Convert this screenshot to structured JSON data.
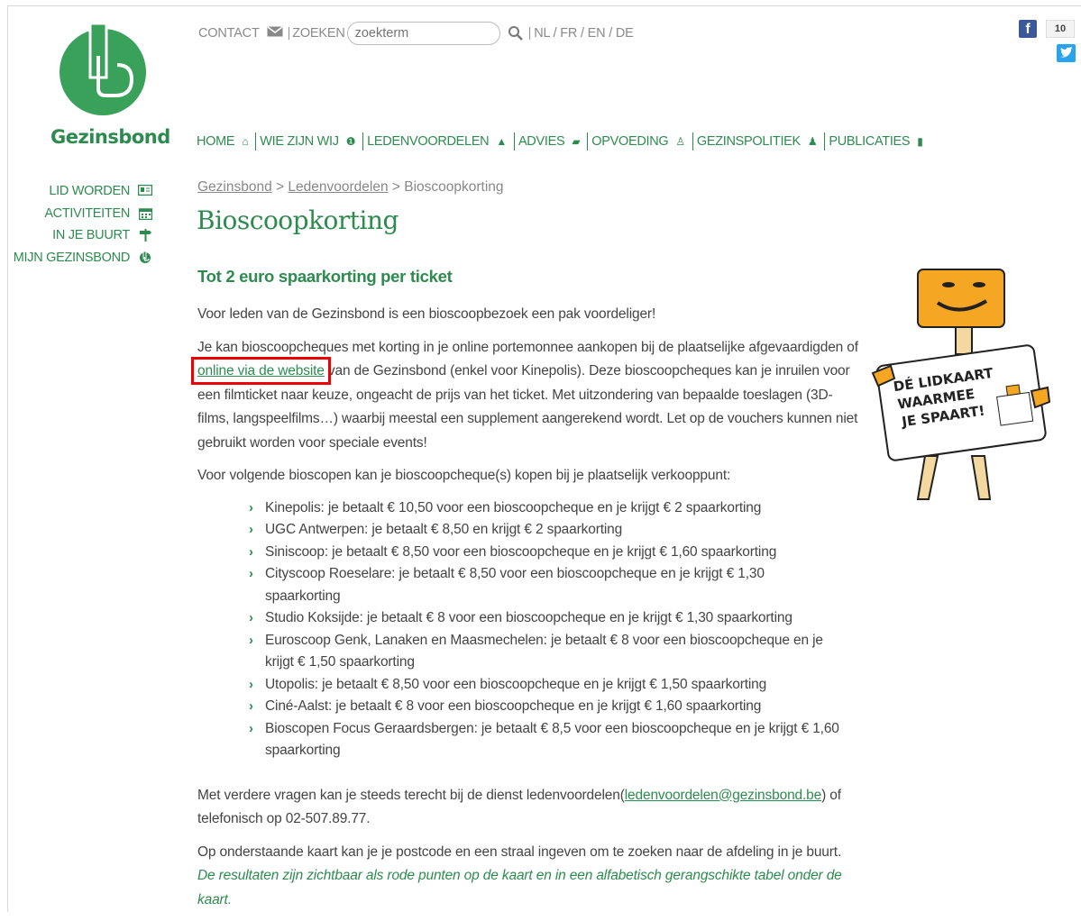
{
  "brand": {
    "name": "Gezinsbond"
  },
  "topbar": {
    "contact_label": "CONTACT",
    "zoeken_label": "ZOEKEN",
    "search_placeholder": "zoekterm",
    "languages": "NL / FR / EN / DE"
  },
  "social": {
    "facebook_count": "10"
  },
  "left_nav": [
    {
      "label": "LID WORDEN",
      "icon": "id-card-icon"
    },
    {
      "label": "ACTIVITEITEN",
      "icon": "calendar-icon"
    },
    {
      "label": "IN JE BUURT",
      "icon": "signpost-icon"
    },
    {
      "label": "MIJN GEZINSBOND",
      "icon": "gezinsbond-logo-icon"
    }
  ],
  "main_nav": [
    {
      "label": "HOME",
      "icon": "home-icon",
      "glyph": "⌂"
    },
    {
      "label": "WIE ZIJN WIJ",
      "icon": "info-icon",
      "glyph": "❶"
    },
    {
      "label": "LEDENVOORDELEN",
      "icon": "user-icon",
      "glyph": "▲"
    },
    {
      "label": "ADVIES",
      "icon": "chat-icon",
      "glyph": "▰"
    },
    {
      "label": "OPVOEDING",
      "icon": "child-icon",
      "glyph": "♙"
    },
    {
      "label": "GEZINSPOLITIEK",
      "icon": "family-icon",
      "glyph": "♟"
    },
    {
      "label": "PUBLICATIES",
      "icon": "book-icon",
      "glyph": "▮"
    }
  ],
  "breadcrumb": {
    "home": "Gezinsbond",
    "sep1": " > ",
    "section": "Ledenvoordelen",
    "sep2": " > ",
    "current": "Bioscoopkorting"
  },
  "page": {
    "title": "Bioscoopkorting",
    "subheading": "Tot 2 euro spaarkorting per ticket",
    "intro": "Voor leden van de Gezinsbond is een bioscoopbezoek een pak voordeliger!",
    "p2_before": "Je kan bioscoopcheques met korting in je online portemonnee aankopen bij de plaatselijke afgevaardigden of ",
    "p2_link": "online via de website",
    "p2_after": " van de Gezinsbond (enkel voor Kinepolis). Deze bioscoopcheques kan je inruilen voor een filmticket naar keuze, ongeacht de prijs van het ticket. Met uitzondering van bepaalde toeslagen (3D-films, langspeelfilms…) waarbij meestal een supplement aangerekend wordt. Let op de vouchers kunnen niet gebruikt worden voor speciale events!",
    "p3": "Voor volgende bioscopen kan je bioscoopcheque(s) kopen bij je plaatselijk verkooppunt:",
    "cinemas": [
      "Kinepolis: je betaalt € 10,50 voor een bioscoopcheque en je krijgt € 2 spaarkorting",
      "UGC Antwerpen: je betaalt € 8,50 en krijgt € 2 spaarkorting",
      "Siniscoop: je betaalt € 8,50 voor een bioscoopcheque en je krijgt € 1,60 spaarkorting",
      "Cityscoop Roeselare: je betaalt € 8,50 voor een bioscoopcheque en je krijgt € 1,30 spaarkorting",
      "Studio Koksijde: je betaalt € 8 voor een bioscoopcheque en je krijgt € 1,30 spaarkorting",
      "Euroscoop Genk, Lanaken en Maasmechelen: je betaalt € 8 voor een bioscoopcheque en je krijgt € 1,50 spaarkorting",
      "Utopolis: je betaalt € 8,50 voor een bioscoopcheque en je krijgt € 1,50 spaarkorting",
      "Ciné-Aalst: je betaalt € 8 voor een bioscoopcheque en je krijgt € 1,60 spaarkorting",
      "Bioscopen Focus Geraardsbergen: je betaalt € 8,5 voor een bioscoopcheque en je krijgt € 1,60 spaarkorting"
    ],
    "p4_before": "Met verdere vragen kan je steeds terecht bij de dienst ledenvoordelen(",
    "p4_email": "ledenvoordelen@gezinsbond.be",
    "p4_after": ") of telefonisch op 02-507.89.77.",
    "p5_before": "Op onderstaande kaart kan je je postcode en een straal ingeven om te zoeken naar de afdeling in je buurt. ",
    "p5_italic": "De resultaten zijn zichtbaar als rode punten op de kaart  en in een alfabetisch gerangschikte tabel onder de kaart."
  },
  "mascot": {
    "card_text_1": "DÉ LIDKAART",
    "card_text_2": "WAARMEE",
    "card_text_3": "JE SPAART!"
  },
  "colors": {
    "brand_green": "#2e8b4f",
    "highlight_red": "#e00000",
    "mascot_orange": "#f5a623"
  }
}
